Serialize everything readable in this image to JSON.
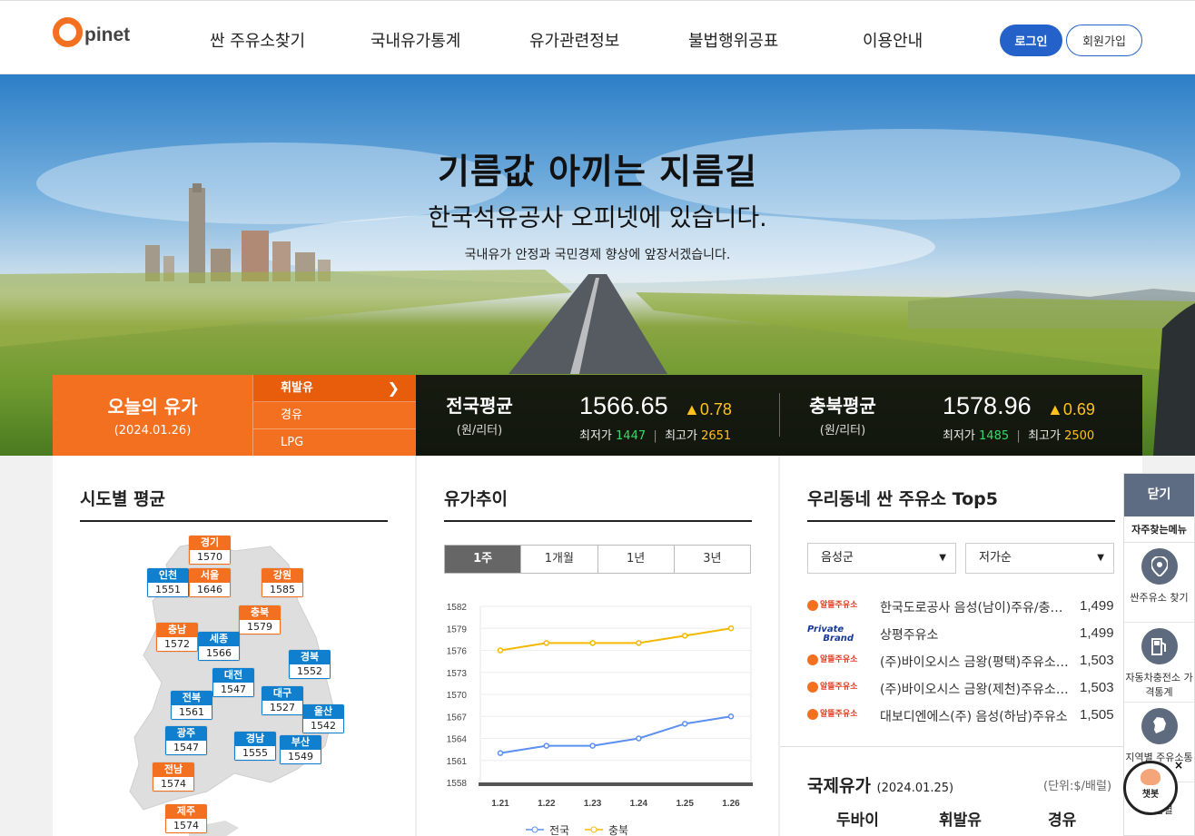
{
  "header": {
    "logo": "pinet",
    "nav": [
      "싼 주유소찾기",
      "국내유가통계",
      "유가관련정보",
      "불법행위공표",
      "이용안내"
    ],
    "login": "로그인",
    "join": "회원가입"
  },
  "hero": {
    "title": "기름값 아끼는 지름길",
    "subtitle": "한국석유공사 오피넷에 있습니다.",
    "desc": "국내유가 안정과 국민경제 향상에 앞장서겠습니다."
  },
  "today": {
    "title": "오늘의 유가",
    "date": "(2024.01.26)",
    "fuels": [
      "휘발유",
      "경유",
      "LPG"
    ]
  },
  "national": {
    "label": "전국평균",
    "unit": "(원/리터)",
    "price": "1566.65",
    "change": "▲0.78",
    "min_label": "최저가",
    "min": "1447",
    "max_label": "최고가",
    "max": "2651"
  },
  "region": {
    "label": "충북평균",
    "unit": "(원/리터)",
    "price": "1578.96",
    "change": "▲0.69",
    "min_label": "최저가",
    "min": "1485",
    "max_label": "최고가",
    "max": "2500"
  },
  "sido": {
    "title": "시도별 평균",
    "cities": [
      {
        "name": "경기",
        "value": "1570"
      },
      {
        "name": "인천",
        "value": "1551"
      },
      {
        "name": "서울",
        "value": "1646"
      },
      {
        "name": "강원",
        "value": "1585"
      },
      {
        "name": "충북",
        "value": "1579"
      },
      {
        "name": "충남",
        "value": "1572"
      },
      {
        "name": "세종",
        "value": "1566"
      },
      {
        "name": "경북",
        "value": "1552"
      },
      {
        "name": "대전",
        "value": "1547"
      },
      {
        "name": "대구",
        "value": "1527"
      },
      {
        "name": "전북",
        "value": "1561"
      },
      {
        "name": "울산",
        "value": "1542"
      },
      {
        "name": "광주",
        "value": "1547"
      },
      {
        "name": "경남",
        "value": "1555"
      },
      {
        "name": "부산",
        "value": "1549"
      },
      {
        "name": "전남",
        "value": "1574"
      },
      {
        "name": "제주",
        "value": "1574"
      }
    ]
  },
  "trend": {
    "title": "유가추이",
    "tabs": [
      "1주",
      "1개월",
      "1년",
      "3년"
    ],
    "legend": [
      "전국",
      "충북"
    ]
  },
  "chart_data": {
    "type": "line",
    "categories": [
      "1.21",
      "1.22",
      "1.23",
      "1.24",
      "1.25",
      "1.26"
    ],
    "series": [
      {
        "name": "전국",
        "values": [
          1562,
          1563,
          1563,
          1564,
          1566,
          1567
        ],
        "color": "#5b8ff0"
      },
      {
        "name": "충북",
        "values": [
          1576,
          1577,
          1577,
          1577,
          1578,
          1579
        ],
        "color": "#f5b800"
      }
    ],
    "yticks": [
      "1582",
      "1579",
      "1576",
      "1573",
      "1570",
      "1567",
      "1564",
      "1561",
      "1558"
    ],
    "ylim": [
      1558,
      1582
    ]
  },
  "top5": {
    "title": "우리동네 싼 주유소 Top5",
    "select_region": "음성군",
    "select_order": "저가순",
    "stations": [
      {
        "brand": "알뜰주유소",
        "name": "한국도로공사 음성(남이)주유/충주방향",
        "price": "1,499"
      },
      {
        "brand": "Private Brand",
        "name": "상평주유소",
        "price": "1,499"
      },
      {
        "brand": "알뜰주유소",
        "name": "(주)바이오시스 금왕(평택)주유소 방향",
        "price": "1,503"
      },
      {
        "brand": "알뜰주유소",
        "name": "(주)바이오시스 금왕(제천)주유소 방향",
        "price": "1,503"
      },
      {
        "brand": "알뜰주유소",
        "name": "대보디엔에스(주) 음성(하남)주유소",
        "price": "1,505"
      }
    ]
  },
  "intl": {
    "title": "국제유가",
    "date": "(2024.01.25)",
    "unit": "(단위:$/배럴)",
    "cols": [
      "두바이",
      "휘발유",
      "경유"
    ]
  },
  "quick": {
    "close": "닫기",
    "title": "자주찾는메뉴",
    "items": [
      "싼주유소 찾기",
      "자동차충전소 가격통계",
      "지역별 주유소통계",
      "제품별"
    ]
  },
  "chatbot": {
    "label": "챗봇",
    "close": "×"
  }
}
